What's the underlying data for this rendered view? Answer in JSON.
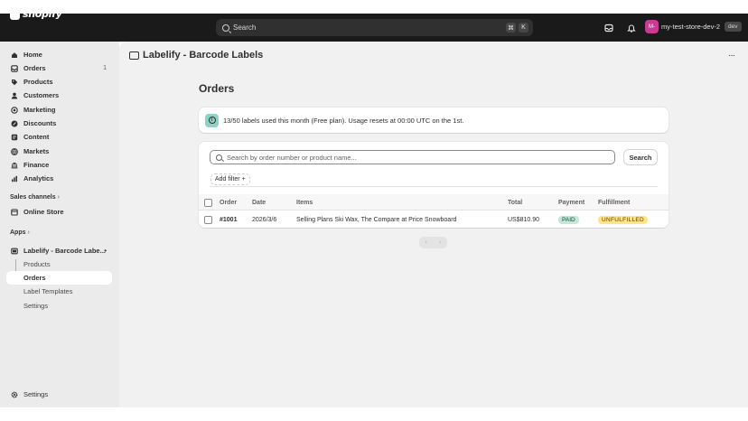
{
  "topbar": {
    "brand": "shopify",
    "search_placeholder": "Search",
    "shortcut_keys": [
      "⌘",
      "K"
    ],
    "store_initials": "M-",
    "store_name": "my-test-store-dev-2",
    "env_badge": "dev"
  },
  "sidebar": {
    "items": [
      {
        "label": "Home",
        "icon": "home-icon"
      },
      {
        "label": "Orders",
        "icon": "orders-icon",
        "count": "1"
      },
      {
        "label": "Products",
        "icon": "tag-icon"
      },
      {
        "label": "Customers",
        "icon": "person-icon"
      },
      {
        "label": "Marketing",
        "icon": "target-icon"
      },
      {
        "label": "Discounts",
        "icon": "discount-icon"
      },
      {
        "label": "Content",
        "icon": "content-icon"
      },
      {
        "label": "Markets",
        "icon": "globe-icon"
      },
      {
        "label": "Finance",
        "icon": "bank-icon"
      },
      {
        "label": "Analytics",
        "icon": "chart-icon"
      }
    ],
    "sales_channels_label": "Sales channels",
    "online_store_label": "Online Store",
    "apps_label": "Apps",
    "app_name": "Labelify - Barcode Labe...",
    "app_subitems": [
      "Products",
      "Orders",
      "Label Templates",
      "Settings"
    ],
    "settings_label": "Settings"
  },
  "header": {
    "app_title": "Labelify - Barcode Labels",
    "more_label": "···"
  },
  "main": {
    "page_title": "Orders",
    "banner_text": "13/50 labels used this month (Free plan). Usage resets at 00:00 UTC on the 1st.",
    "search_placeholder": "Search by order number or product name...",
    "search_button": "Search",
    "add_filter": "Add filter +",
    "columns": [
      "Order",
      "Date",
      "Items",
      "Total",
      "Payment",
      "Fulfillment"
    ],
    "rows": [
      {
        "order": "#1001",
        "date": "2026/3/6",
        "items": "Selling Plans Ski Wax, The Compare at Price Snowboard",
        "total": "US$810.90",
        "payment": "PAID",
        "fulfillment": "UNFULFILLED"
      }
    ],
    "pager_prev": "‹",
    "pager_next": "›"
  },
  "colors": {
    "topbar": "#1a1a1a",
    "sidebar": "#ebebeb",
    "main_bg": "#f1f1f1",
    "paid_badge": "#c5e6d8",
    "unfulfilled_badge": "#ffe585",
    "avatar": "#c93a96"
  }
}
